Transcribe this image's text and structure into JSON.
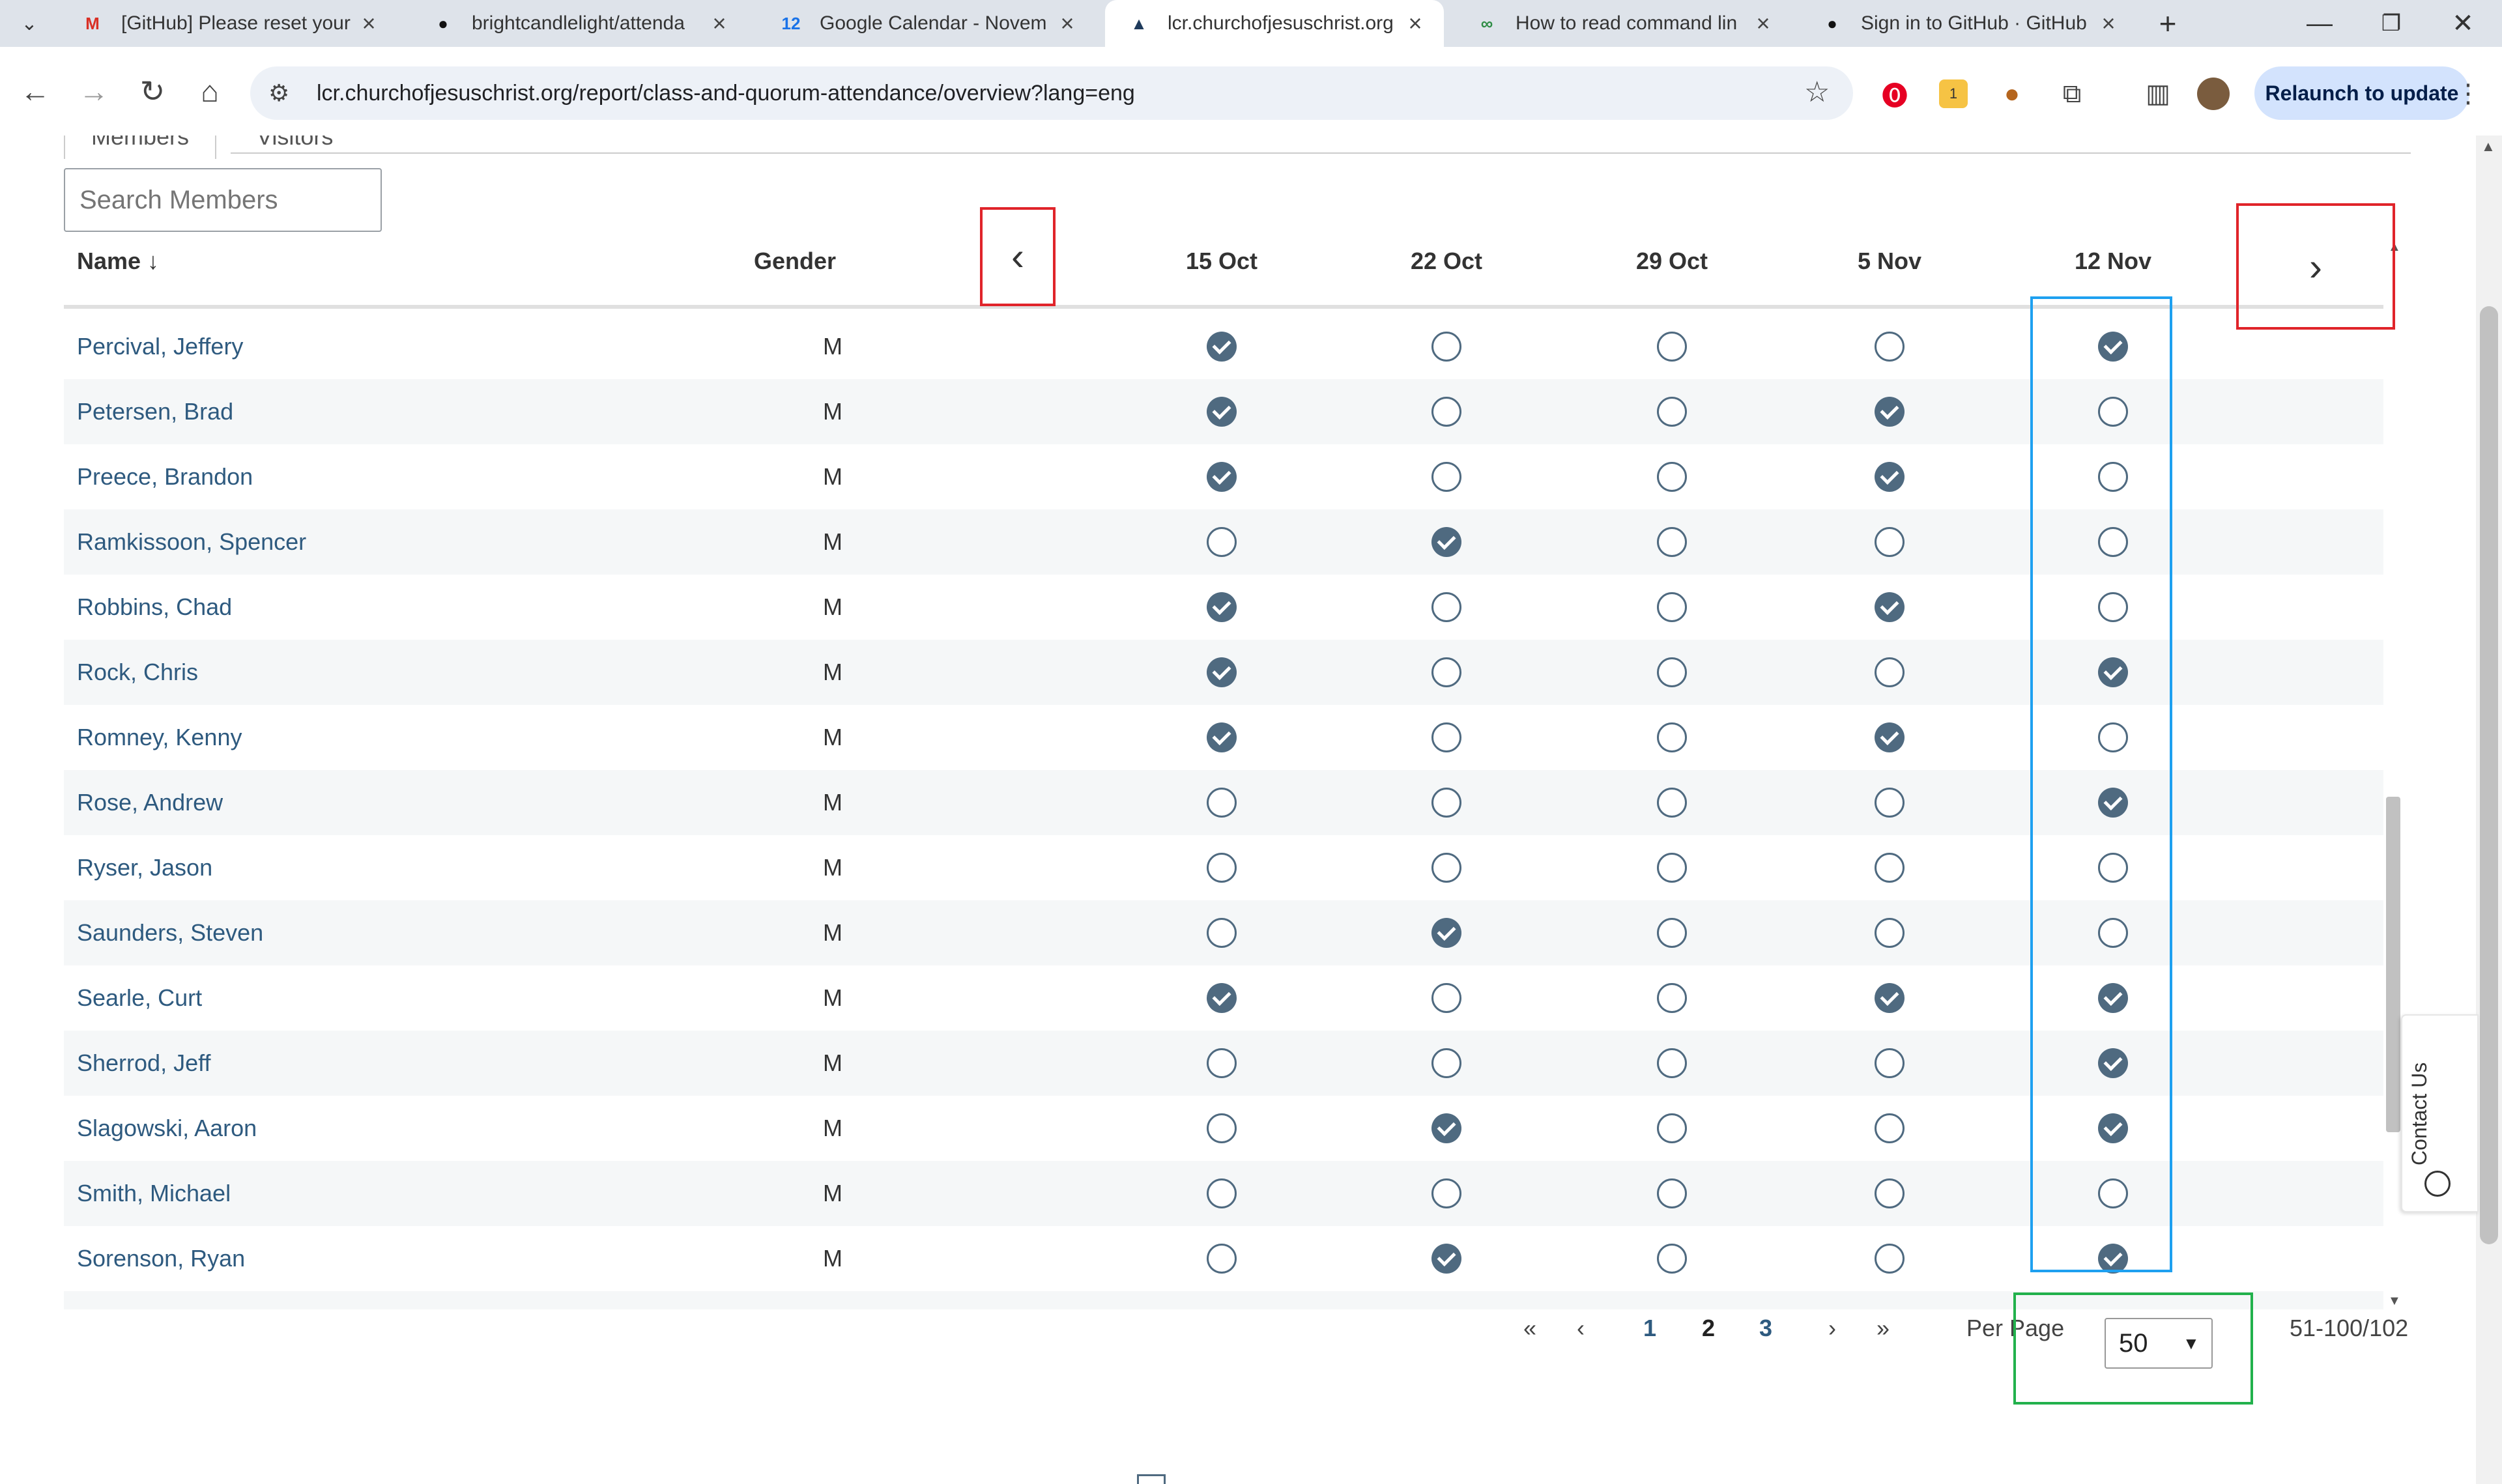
{
  "browser": {
    "tabs": [
      {
        "title": "[GitHub] Please reset your",
        "icon": "gmail-icon",
        "glyph": "M",
        "color": "#d93025"
      },
      {
        "title": "brightcandlelight/attenda",
        "icon": "github-icon",
        "glyph": "●",
        "color": "#111"
      },
      {
        "title": "Google Calendar - Novem",
        "icon": "calendar-icon",
        "glyph": "12",
        "color": "#1a73e8"
      },
      {
        "title": "lcr.churchofjesuschrist.org",
        "icon": "church-icon",
        "glyph": "▲",
        "color": "#1f3b5c"
      },
      {
        "title": "How to read command lin",
        "icon": "gfg-icon",
        "glyph": "∞",
        "color": "#2f8d46"
      },
      {
        "title": "Sign in to GitHub · GitHub",
        "icon": "github-icon",
        "glyph": "●",
        "color": "#111"
      }
    ],
    "active_tab": 3,
    "url": "lcr.churchofjesuschrist.org/report/class-and-quorum-attendance/overview?lang=eng",
    "relaunch_label": "Relaunch to update"
  },
  "subtabs": {
    "members": "Members",
    "visitors": "Visitors"
  },
  "search": {
    "placeholder": "Search Members"
  },
  "table": {
    "headers": {
      "name": "Name ↓",
      "gender": "Gender"
    },
    "dates": [
      "15 Oct",
      "22 Oct",
      "29 Oct",
      "5 Nov",
      "12 Nov"
    ],
    "rows": [
      {
        "name": "Percival, Jeffery",
        "gender": "M",
        "attendance": [
          1,
          0,
          0,
          0,
          1
        ]
      },
      {
        "name": "Petersen, Brad",
        "gender": "M",
        "attendance": [
          1,
          0,
          0,
          1,
          0
        ]
      },
      {
        "name": "Preece, Brandon",
        "gender": "M",
        "attendance": [
          1,
          0,
          0,
          1,
          0
        ]
      },
      {
        "name": "Ramkissoon, Spencer",
        "gender": "M",
        "attendance": [
          0,
          1,
          0,
          0,
          0
        ]
      },
      {
        "name": "Robbins, Chad",
        "gender": "M",
        "attendance": [
          1,
          0,
          0,
          1,
          0
        ]
      },
      {
        "name": "Rock, Chris",
        "gender": "M",
        "attendance": [
          1,
          0,
          0,
          0,
          1
        ]
      },
      {
        "name": "Romney, Kenny",
        "gender": "M",
        "attendance": [
          1,
          0,
          0,
          1,
          0
        ]
      },
      {
        "name": "Rose, Andrew",
        "gender": "M",
        "attendance": [
          0,
          0,
          0,
          0,
          1
        ]
      },
      {
        "name": "Ryser, Jason",
        "gender": "M",
        "attendance": [
          0,
          0,
          0,
          0,
          0
        ]
      },
      {
        "name": "Saunders, Steven",
        "gender": "M",
        "attendance": [
          0,
          1,
          0,
          0,
          0
        ]
      },
      {
        "name": "Searle, Curt",
        "gender": "M",
        "attendance": [
          1,
          0,
          0,
          1,
          1
        ]
      },
      {
        "name": "Sherrod, Jeff",
        "gender": "M",
        "attendance": [
          0,
          0,
          0,
          0,
          1
        ]
      },
      {
        "name": "Slagowski, Aaron",
        "gender": "M",
        "attendance": [
          0,
          1,
          0,
          0,
          1
        ]
      },
      {
        "name": "Smith, Michael",
        "gender": "M",
        "attendance": [
          0,
          0,
          0,
          0,
          0
        ]
      },
      {
        "name": "Sorenson, Ryan",
        "gender": "M",
        "attendance": [
          0,
          1,
          0,
          0,
          1
        ]
      }
    ]
  },
  "pagination": {
    "first": "«",
    "prev": "‹",
    "pages": [
      "1",
      "2",
      "3"
    ],
    "next": "›",
    "last": "»",
    "per_page_label": "Per Page",
    "per_page_value": "50",
    "range": "51-100/102"
  },
  "contact": "Contact Us",
  "colors": {
    "accent": "#4f6a80",
    "link": "#2e5a7f",
    "highlight_red": "#e0242a",
    "highlight_blue": "#1ea0f0",
    "highlight_green": "#22b14c"
  }
}
